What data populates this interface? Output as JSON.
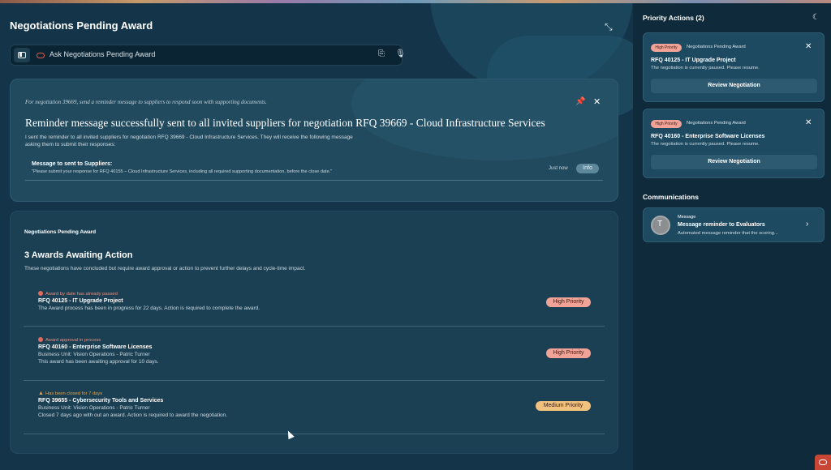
{
  "header": {
    "title": "Negotiations Pending Award",
    "collapse_icon": "collapse-arrows-icon"
  },
  "ask": {
    "placeholder": "Ask Negotiations Pending Award",
    "icons": [
      "panel-icon",
      "oracle-icon",
      "attachment-icon",
      "microphone-icon"
    ]
  },
  "response": {
    "prompt": "For negotiation 39669, send a reminder message to suppliers to respond soon with supporting documents.",
    "headline": "Reminder message successfully sent to all invited suppliers for negotiation RFQ 39669 - Cloud Infrastructure Services",
    "body": "I sent the reminder to all invited suppliers for negotiation RFQ 39669 - Cloud Infrastructure Services. They will receive the following message asking them to submit their responses:",
    "message_label": "Message to sent to Suppliers:",
    "message_text": "\"Please submit your response for RFQ 40155 – Cloud Infrastructure Services, including all required supporting documentation, before the close date.\"",
    "time": "Just now",
    "badge": "Info"
  },
  "awards": {
    "section_label": "Negotiations Pending Award",
    "heading": "3 Awards Awaiting Action",
    "description": "These negotiations have concluded but require award approval or action to prevent further delays and cycle-time impact.",
    "rows": [
      {
        "status": "Award by date has already passed",
        "title": "RFQ 40125 - IT Upgrade Project",
        "line1": "The Award process has been in progress for 22 days. Action is required to complete the award.",
        "line2": "",
        "priority": "High Priority"
      },
      {
        "status": "Award approval in process",
        "title": "RFQ 40160 - Enterprise Software Licenses",
        "line1": "Business Unit: Vision Operations - Patric Turner",
        "line2": "This award has been awaiting approval for 10 days.",
        "priority": "High Priority"
      },
      {
        "status": "Has been closed for 7 days",
        "title": "RFQ 39655 - Cybersecurity Tools and Services",
        "line1": "Business Unit: Vision Operations - Patric Turner",
        "line2": "Closed 7 days ago with out an award. Action is required to award the negotiation.",
        "priority": "Medium Priority"
      }
    ]
  },
  "sidebar": {
    "title": "Priority Actions (2)",
    "theme_icon": "moon-icon",
    "priority_cards": [
      {
        "badge": "High Priority",
        "category": "Negotiations Pending Award",
        "title": "RFQ 40125 - IT Upgrade Project",
        "desc": "The negotiation is currently paused. Please resume.",
        "button": "Review Negotiation"
      },
      {
        "badge": "High Priority",
        "category": "Negotiations Pending Award",
        "title": "RFQ 40160 - Enterprise Software Licenses",
        "desc": "The negotiation is currently paused. Please resume.",
        "button": "Review Negotiation"
      }
    ],
    "communications_title": "Communications",
    "communication": {
      "label": "Message",
      "title": "Message reminder to Evaluators",
      "desc": "Automated message reminder that the scoring..."
    }
  },
  "colors": {
    "background": "#143549",
    "sidebar": "#0f2a3a",
    "high_priority": "#f2a397",
    "medium_priority": "#f1c27e",
    "oracle_red": "#c74634"
  }
}
